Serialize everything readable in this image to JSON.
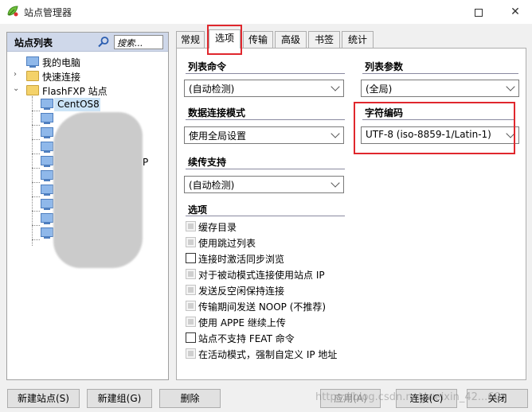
{
  "window": {
    "title": "站点管理器",
    "minimize_glyph": "—",
    "close_glyph": "✕",
    "app_icon": "flashfxp-leaf-icon"
  },
  "site_panel": {
    "title": "站点列表",
    "search_placeholder": "搜索...",
    "tree": [
      {
        "label": "我的电脑",
        "icon": "computer-icon"
      },
      {
        "label": "快速连接",
        "icon": "folder-icon"
      },
      {
        "label": "FlashFXP 站点",
        "icon": "folder-icon"
      },
      {
        "label": "CentOS8",
        "icon": "server-icon",
        "selected": true
      }
    ],
    "partial_label": "P"
  },
  "tabs": [
    {
      "label": "常规"
    },
    {
      "label": "选项",
      "active": true
    },
    {
      "label": "传输"
    },
    {
      "label": "高级"
    },
    {
      "label": "书签"
    },
    {
      "label": "统计"
    }
  ],
  "options": {
    "list_command_label": "列表命令",
    "list_command_value": "(自动检测)",
    "list_params_label": "列表参数",
    "list_params_value": "(全局)",
    "data_mode_label": "数据连接模式",
    "data_mode_value": "使用全局设置",
    "encoding_label": "字符编码",
    "encoding_value": "UTF-8 (iso-8859-1/Latin-1)",
    "resume_label": "续传支持",
    "resume_value": "(自动检测)",
    "options_label": "选项",
    "checkboxes": [
      {
        "label": "缓存目录",
        "enabled": false
      },
      {
        "label": "使用跳过列表",
        "enabled": false
      },
      {
        "label": "连接时激活同步浏览",
        "enabled": true
      },
      {
        "label": "对于被动模式连接使用站点 IP",
        "enabled": false
      },
      {
        "label": "发送反空闲保持连接",
        "enabled": false
      },
      {
        "label": "传输期间发送 NOOP (不推荐)",
        "enabled": false
      },
      {
        "label": "使用 APPE 继续上传",
        "enabled": false
      },
      {
        "label": "站点不支持 FEAT 命令",
        "enabled": true
      },
      {
        "label": "在活动模式，强制自定义 IP 地址",
        "enabled": false
      }
    ]
  },
  "buttons": {
    "new_site": "新建站点(S)",
    "new_group": "新建组(G)",
    "delete": "删除",
    "apply": "应用(A)",
    "connect": "连接(C)",
    "close": "关闭"
  },
  "watermark": "https://blog.csdn.net/weixin_42...60",
  "colors": {
    "highlight_red": "#e0272d",
    "selection": "#cce4f7",
    "panel_header": "#cfd8ea"
  }
}
